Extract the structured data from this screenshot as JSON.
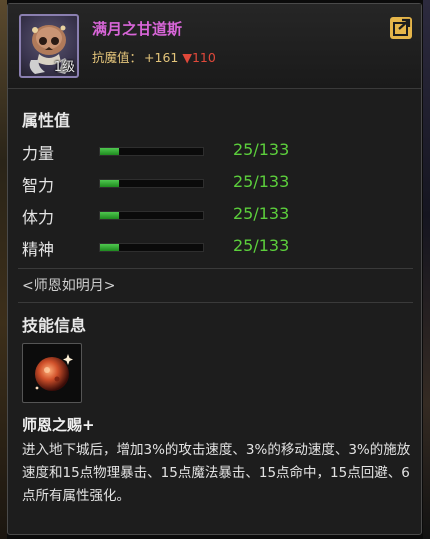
{
  "pet": {
    "name": "满月之甘道斯",
    "level": "1级",
    "resist_label": "抗魔值：",
    "resist_plus": "+161",
    "resist_down": "▼110"
  },
  "stats": {
    "heading": "属性值",
    "items": [
      {
        "label": "力量",
        "value": "25/133",
        "fill": 0.188
      },
      {
        "label": "智力",
        "value": "25/133",
        "fill": 0.188
      },
      {
        "label": "体力",
        "value": "25/133",
        "fill": 0.188
      },
      {
        "label": "精神",
        "value": "25/133",
        "fill": 0.188
      }
    ]
  },
  "title_text": "<师恩如明月>",
  "skill": {
    "heading": "技能信息",
    "name": "师恩之赐+",
    "description": "进入地下城后，增加3%的攻击速度、3%的移动速度、3%的施放速度和15点物理暴击、15点魔法暴击、15点命中，15点回避、6点所有属性强化。"
  },
  "colors": {
    "name": "#d966d9",
    "resist": "#e3c47a",
    "down": "#e0483a",
    "stat_value": "#5ccf3c",
    "bar_fill": "#3fb83f"
  },
  "icons": {
    "share": "share-icon",
    "portrait": "skull-pet-portrait",
    "skill": "moon-orb-icon"
  }
}
